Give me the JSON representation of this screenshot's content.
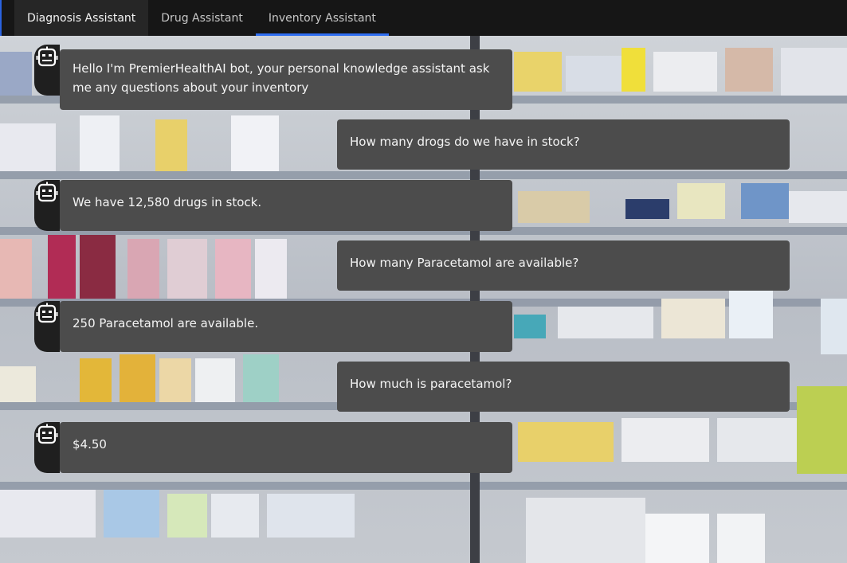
{
  "tabs": [
    {
      "label": "Diagnosis Assistant"
    },
    {
      "label": "Drug Assistant"
    },
    {
      "label": "Inventory Assistant"
    }
  ],
  "active_tab": "Inventory Assistant",
  "accent_color": "#2f6ef0",
  "bot_icon": "robot-face-icon",
  "messages": [
    {
      "role": "bot",
      "text": "Hello I'm PremierHealthAI bot, your personal knowledge assistant ask me any questions about your inventory"
    },
    {
      "role": "user",
      "text": "How many drogs do we have in stock?"
    },
    {
      "role": "bot",
      "text": "We have 12,580 drugs in stock."
    },
    {
      "role": "user",
      "text": "How many Paracetamol are available?"
    },
    {
      "role": "bot",
      "text": "250 Paracetamol are available."
    },
    {
      "role": "user",
      "text": "How much is paracetamol?"
    },
    {
      "role": "bot",
      "text": "$4.50"
    }
  ]
}
